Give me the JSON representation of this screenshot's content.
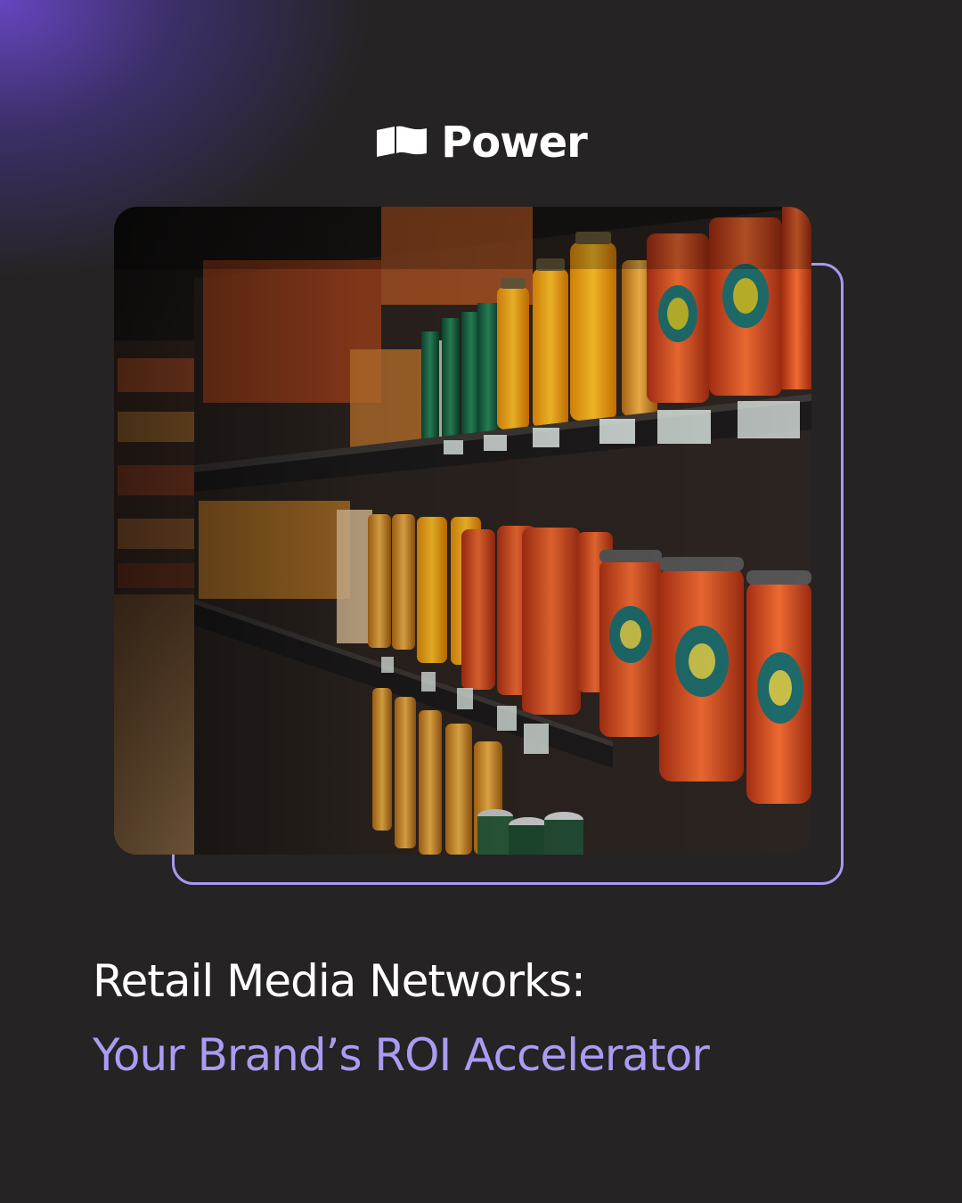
{
  "brand": {
    "name": "Power",
    "logo_icon": "power-flag-logo"
  },
  "hero_image": {
    "subject": "supermarket-shelf-photo"
  },
  "headline": {
    "line1": "Retail Media Networks:",
    "line2": "Your Brand’s ROI Accelerator"
  },
  "colors": {
    "background": "#252323",
    "accent_purple": "#a99cf2",
    "outline": "#a898f0",
    "glow": "#6848c8",
    "text_primary": "#ffffff"
  }
}
